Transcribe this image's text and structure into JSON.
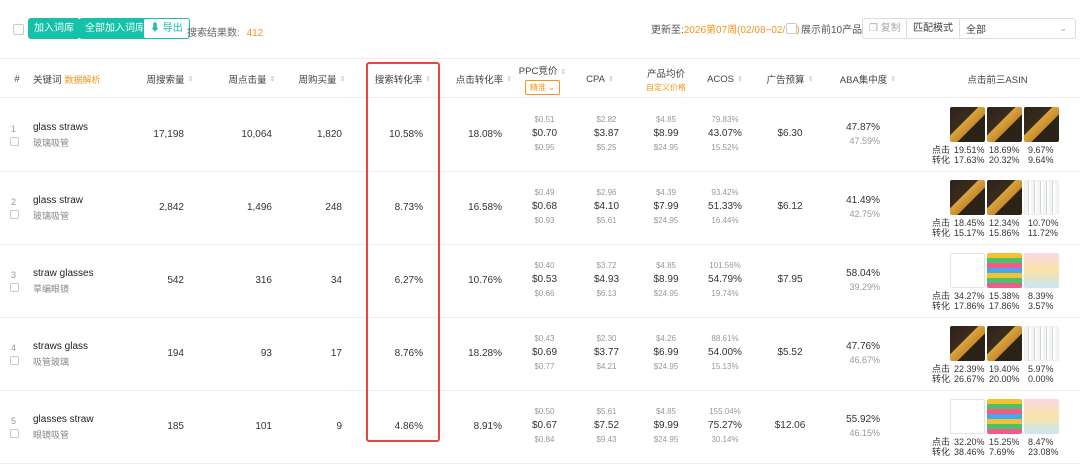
{
  "toolbar": {
    "add_label": "加入词库",
    "add_all_label": "全部加入词库",
    "export_label": "导出",
    "result_label": "搜索结果数:",
    "result_count": "412",
    "updated_label": "更新至:",
    "updated_value": "2026第07周(02/08~02/14)",
    "top10_label": "展示前10产品图",
    "copy_label": "复制",
    "match_label": "匹配模式",
    "match_value": "全部"
  },
  "columns": {
    "index": "#",
    "keyword": "关键词",
    "keyword_link": "数据解析",
    "week_search": "周搜索量",
    "week_click": "周点击量",
    "week_buy": "周购买量",
    "search_cvr": "搜索转化率",
    "click_cvr": "点击转化率",
    "ppc": "PPC竞价",
    "ppc_mode": "精准",
    "cpa": "CPA",
    "avg_price": "产品均价",
    "avg_price_link": "自定义价格",
    "acos": "ACOS",
    "ad_budget": "广告预算",
    "aba": "ABA集中度",
    "top3": "点击前三ASIN"
  },
  "labels": {
    "click": "点击",
    "conv": "转化"
  },
  "rows": [
    {
      "index": "1",
      "kw": "glass straws",
      "cn": "玻璃吸管",
      "search": "17,198",
      "click": "10,064",
      "buy": "1,820",
      "scvr": "10.58%",
      "ccvr": "18.08%",
      "ppc": [
        "$0.51",
        "$0.70",
        "$0.95"
      ],
      "cpa": [
        "$2.82",
        "$3.87",
        "$5.25"
      ],
      "price": [
        "$4.85",
        "$8.99",
        "$24.95"
      ],
      "acos": [
        "79.83%",
        "43.07%",
        "15.52%"
      ],
      "budget": "$6.30",
      "aba": [
        "47.87%",
        "47.59%"
      ],
      "clk": [
        "19.51%",
        "18.69%",
        "9.67%"
      ],
      "cvr": [
        "17.63%",
        "20.32%",
        "9.64%"
      ],
      "thumbs": [
        "box",
        "box",
        "box"
      ]
    },
    {
      "index": "2",
      "kw": "glass straw",
      "cn": "玻璃吸管",
      "search": "2,842",
      "click": "1,496",
      "buy": "248",
      "scvr": "8.73%",
      "ccvr": "16.58%",
      "ppc": [
        "$0.49",
        "$0.68",
        "$0.93"
      ],
      "cpa": [
        "$2.96",
        "$4.10",
        "$5.61"
      ],
      "price": [
        "$4.39",
        "$7.99",
        "$24.95"
      ],
      "acos": [
        "93.42%",
        "51.33%",
        "16.44%"
      ],
      "budget": "$6.12",
      "aba": [
        "41.49%",
        "42.75%"
      ],
      "clk": [
        "18.45%",
        "12.34%",
        "10.70%"
      ],
      "cvr": [
        "15.17%",
        "15.86%",
        "11.72%"
      ],
      "thumbs": [
        "box",
        "box",
        "straw"
      ]
    },
    {
      "index": "3",
      "kw": "straw glasses",
      "cn": "草编眼镜",
      "search": "542",
      "click": "316",
      "buy": "34",
      "scvr": "6.27%",
      "ccvr": "10.76%",
      "ppc": [
        "$0.40",
        "$0.53",
        "$0.66"
      ],
      "cpa": [
        "$3.72",
        "$4.93",
        "$6.13"
      ],
      "price": [
        "$4.85",
        "$8.99",
        "$24.95"
      ],
      "acos": [
        "101.56%",
        "54.79%",
        "19.74%"
      ],
      "budget": "$7.95",
      "aba": [
        "58.04%",
        "39.29%"
      ],
      "clk": [
        "34.27%",
        "15.38%",
        "8.39%"
      ],
      "cvr": [
        "17.86%",
        "17.86%",
        "3.57%"
      ],
      "thumbs": [
        "glasses",
        "colorful",
        "kid"
      ]
    },
    {
      "index": "4",
      "kw": "straws glass",
      "cn": "吸管玻璃",
      "search": "194",
      "click": "93",
      "buy": "17",
      "scvr": "8.76%",
      "ccvr": "18.28%",
      "ppc": [
        "$0.43",
        "$0.69",
        "$0.77"
      ],
      "cpa": [
        "$2.30",
        "$3.77",
        "$4.21"
      ],
      "price": [
        "$4.26",
        "$6.99",
        "$24.95"
      ],
      "acos": [
        "88.61%",
        "54.00%",
        "15.13%"
      ],
      "budget": "$5.52",
      "aba": [
        "47.76%",
        "46.67%"
      ],
      "clk": [
        "22.39%",
        "19.40%",
        "5.97%"
      ],
      "cvr": [
        "26.67%",
        "20.00%",
        "0.00%"
      ],
      "thumbs": [
        "box",
        "box",
        "straw"
      ]
    },
    {
      "index": "5",
      "kw": "glasses straw",
      "cn": "眼镜吸管",
      "search": "185",
      "click": "101",
      "buy": "9",
      "scvr": "4.86%",
      "ccvr": "8.91%",
      "ppc": [
        "$0.50",
        "$0.67",
        "$0.84"
      ],
      "cpa": [
        "$5.61",
        "$7.52",
        "$9.43"
      ],
      "price": [
        "$4.85",
        "$9.99",
        "$24.95"
      ],
      "acos": [
        "155.04%",
        "75.27%",
        "30.14%"
      ],
      "budget": "$12.06",
      "aba": [
        "55.92%",
        "46.15%"
      ],
      "clk": [
        "32.20%",
        "15.25%",
        "8.47%"
      ],
      "cvr": [
        "38.46%",
        "7.69%",
        "23.08%"
      ],
      "thumbs": [
        "glasses",
        "colorful",
        "kid"
      ]
    }
  ],
  "colors": {
    "accent": "#13c2a8",
    "orange": "#f7931e",
    "highlight": "#e5473f"
  },
  "icons": {
    "export": "download-icon",
    "copy": "copy-icon",
    "select": "chevron-down-icon",
    "sort": "sort-icon"
  }
}
